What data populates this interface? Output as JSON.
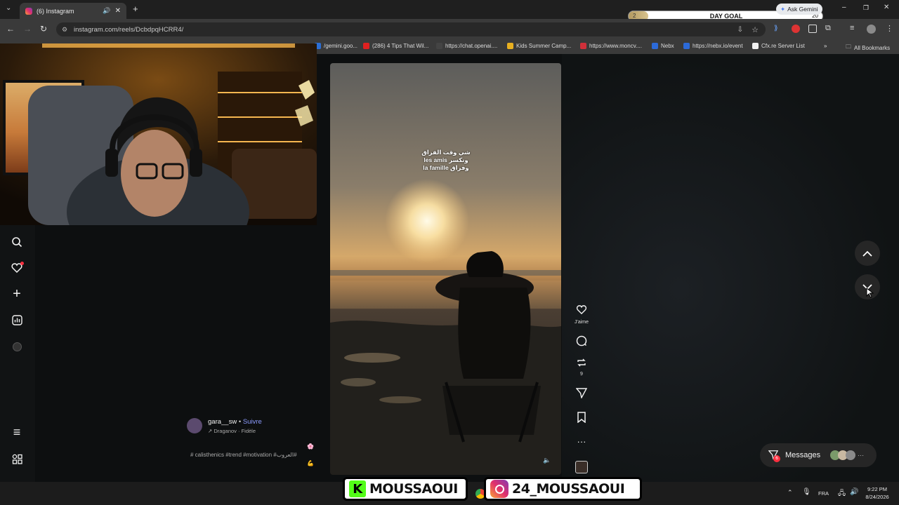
{
  "browser": {
    "tab_title": "(6) Instagram",
    "url": "instagram.com/reels/DcbdpqHCRR4/",
    "day_goal_label": "DAY GOAL",
    "day_goal_current": "2",
    "day_goal_target": "20",
    "day_goal_fraction": 0.1,
    "ask_gemini": "Ask Gemini",
    "bookmarks": [
      {
        "label": "/gemini.goo...",
        "color": "#2b6fd6"
      },
      {
        "label": "(286) 4 Tips That Wil...",
        "color": "#e02020"
      },
      {
        "label": "https://chat.openai....",
        "color": "#444444"
      },
      {
        "label": "Kids Summer Camp...",
        "color": "#e8b020"
      },
      {
        "label": "https://www.moncv....",
        "color": "#d0303a"
      },
      {
        "label": "Nebx",
        "color": "#2c6ad8"
      },
      {
        "label": "https://nebx.io/event",
        "color": "#2c6ad8"
      },
      {
        "label": "Cfx.re Server List",
        "color": "#f2f2f2"
      }
    ],
    "all_bookmarks": "All Bookmarks"
  },
  "reel": {
    "caption_lines": [
      "شي وقت الفراق",
      "les amis ونكسر",
      "la famille وفراق"
    ],
    "likes_label": "J'aime",
    "reposts_count": "9",
    "username": "gara__sw",
    "follow_label": "Suivre",
    "separator": "•",
    "audio": "Draganov · Fidèle",
    "hashtags": "# calisthenics #trend #motivation #العروب#"
  },
  "messages": {
    "label": "Messages",
    "badge": "6"
  },
  "taskbar": {
    "language": "FRA",
    "time": "9:22 PM",
    "date": "8/24/2026"
  },
  "stream_overlay": {
    "kick_handle": "MOUSSAOUI",
    "instagram_handle": "24_MOUSSAOUI"
  },
  "colors": {
    "follow": "#8c9cff",
    "notification": "#ff3040",
    "kick": "#53fc18"
  }
}
